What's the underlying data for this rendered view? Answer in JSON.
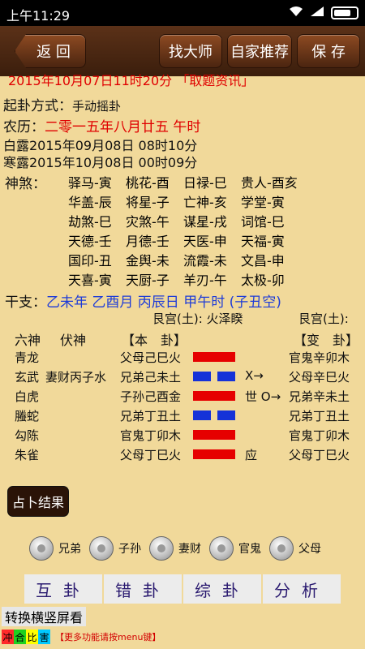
{
  "statusbar": {
    "time": "上午11:29"
  },
  "toolbar": {
    "back_label": "返 回",
    "find_master_label": "找大师",
    "recommend_label": "自家推荐",
    "save_label": "保 存"
  },
  "info": {
    "cut_line": "2015年10月07日11时20分  「取题资讯」",
    "method_label": "起卦方式：",
    "method_value": "手动摇卦",
    "lunar_label": "农历：",
    "lunar_value": "二零一五年八月廿五 午时",
    "bailu": "白露2015年09月08日 08时10分",
    "hanlu": "寒露2015年10月08日 00时09分"
  },
  "shensha": {
    "label": "神煞：",
    "rows": [
      [
        "驿马-寅",
        "桃花-酉",
        "日禄-巳",
        "贵人-酉亥"
      ],
      [
        "华盖-辰",
        "将星-子",
        "亡神-亥",
        "学堂-寅"
      ],
      [
        "劫煞-巳",
        "灾煞-午",
        "谋星-戌",
        "词馆-巳"
      ],
      [
        "天德-壬",
        "月德-壬",
        "天医-申",
        "天福-寅"
      ],
      [
        "国印-丑",
        "金舆-未",
        "流霞-未",
        "文昌-申"
      ],
      [
        "天喜-寅",
        "天厨-子",
        "羊刃-午",
        "太极-卯"
      ]
    ]
  },
  "ganzhi": {
    "label": "干支：",
    "value": "乙未年 乙酉月 丙辰日 甲午时 (子丑空)"
  },
  "hexagram": {
    "left_palace": "艮宫(土):",
    "left_name": "火泽睽",
    "right_palace": "艮宫(土):",
    "col_liushen": "六神",
    "col_fushen": "伏神",
    "col_ben": "【本　卦】",
    "col_bian": "【变　卦】",
    "rows": [
      {
        "god": "青龙",
        "fushen": "",
        "ben": "父母己巳火",
        "yang": true,
        "mark": "",
        "bian": "官鬼辛卯木"
      },
      {
        "god": "玄武",
        "fushen": "妻财丙子水",
        "ben": "兄弟己未土",
        "yang": false,
        "mark": "X→",
        "bian": "父母辛巳火"
      },
      {
        "god": "白虎",
        "fushen": "",
        "ben": "子孙己酉金",
        "yang": true,
        "mark": "世 O→",
        "bian": "兄弟辛未土"
      },
      {
        "god": "螣蛇",
        "fushen": "",
        "ben": "兄弟丁丑土",
        "yang": false,
        "mark": "",
        "bian": "兄弟丁丑土"
      },
      {
        "god": "勾陈",
        "fushen": "",
        "ben": "官鬼丁卯木",
        "yang": true,
        "mark": "",
        "bian": "官鬼丁卯木"
      },
      {
        "god": "朱雀",
        "fushen": "",
        "ben": "父母丁巳火",
        "yang": true,
        "mark": "应",
        "bian": "父母丁巳火"
      }
    ]
  },
  "result_button": "占卜结果",
  "radios": [
    "兄弟",
    "子孙",
    "妻财",
    "官鬼",
    "父母"
  ],
  "tabs": [
    "互卦",
    "错卦",
    "综卦",
    "分析"
  ],
  "rotate_button": "转换横竖屏看",
  "legend": [
    {
      "text": "冲",
      "bg": "#ff2a2a",
      "fg": "#000"
    },
    {
      "text": "合",
      "bg": "#1fd11f",
      "fg": "#000"
    },
    {
      "text": "比",
      "bg": "#ffff00",
      "fg": "#000"
    },
    {
      "text": "害",
      "bg": "#00c8ff",
      "fg": "#000"
    }
  ],
  "hint": "【更多功能请按menu键】",
  "colors": {
    "yang_line": "#e60000",
    "yin_line": "#1532d8"
  }
}
